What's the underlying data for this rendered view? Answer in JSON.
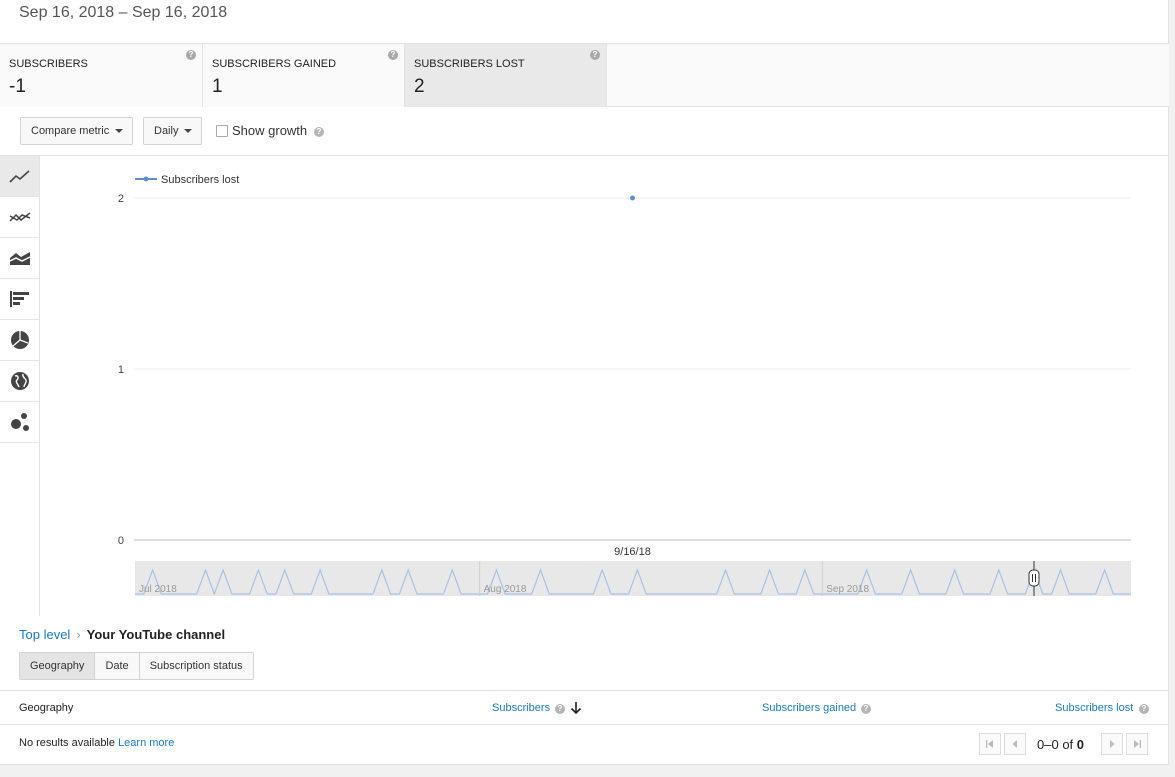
{
  "header": {
    "date_range": "Sep 16, 2018 – Sep 16, 2018"
  },
  "metrics": [
    {
      "label": "SUBSCRIBERS",
      "value": "-1"
    },
    {
      "label": "SUBSCRIBERS GAINED",
      "value": "1"
    },
    {
      "label": "SUBSCRIBERS LOST",
      "value": "2",
      "selected": true
    }
  ],
  "help_glyph": "?",
  "controls": {
    "compare_metric": "Compare metric",
    "interval": "Daily",
    "show_growth": "Show growth",
    "show_growth_checked": false
  },
  "sidebar": {
    "icons": [
      "line-chart-icon",
      "multiline-chart-icon",
      "stacked-area-chart-icon",
      "bar-chart-icon",
      "pie-chart-icon",
      "globe-map-icon",
      "bubble-chart-icon"
    ],
    "active_index": 0
  },
  "chart_data": {
    "type": "line",
    "title": "",
    "legend": {
      "entries": [
        "Subscribers lost"
      ],
      "placement": "top-left"
    },
    "x": [
      "9/16/18"
    ],
    "series": [
      {
        "name": "Subscribers lost",
        "values": [
          2
        ],
        "color": "#5b8fd6"
      }
    ],
    "ylim": [
      0,
      2
    ],
    "yticks": [
      "0",
      "1",
      "2"
    ],
    "xlabel": "",
    "ylabel": "",
    "grid": true,
    "overview": {
      "months": [
        "Jul 2018",
        "Aug 2018",
        "Sep 2018"
      ],
      "values": [
        0,
        0,
        1,
        0,
        0,
        0,
        0,
        0,
        1,
        0,
        1,
        0,
        0,
        0,
        1,
        0,
        0,
        1,
        0,
        0,
        0,
        1,
        0,
        0,
        0,
        0,
        0,
        0,
        1,
        0,
        0,
        1,
        0,
        0,
        0,
        0,
        1,
        0,
        0,
        0,
        0,
        1,
        0,
        0,
        0,
        0,
        1,
        0,
        0,
        0,
        0,
        0,
        0,
        1,
        0,
        0,
        0,
        1,
        0,
        0,
        0,
        0,
        0,
        0,
        0,
        0,
        0,
        1,
        0,
        0,
        0,
        0,
        1,
        0,
        0,
        0,
        1,
        0,
        0,
        0,
        0,
        0,
        0,
        1,
        0,
        0,
        0,
        0,
        1,
        0,
        0,
        0,
        0,
        1,
        0,
        0,
        0,
        0,
        1,
        0,
        0,
        0,
        1,
        0,
        0,
        1,
        0,
        0,
        0,
        0,
        1,
        0,
        0,
        0
      ]
    }
  },
  "breadcrumb": {
    "top": "Top level",
    "separator": "›",
    "current": "Your YouTube channel"
  },
  "tabs": [
    "Geography",
    "Date",
    "Subscription status"
  ],
  "table": {
    "columns": [
      "Geography",
      "Subscribers",
      "Subscribers gained",
      "Subscribers lost"
    ],
    "sort_icon": "arrow-down-icon",
    "no_results": "No results available",
    "learn_more": "Learn more"
  },
  "pager": {
    "range": "0–0",
    "of": "of",
    "total": "0"
  },
  "colors": {
    "accent": "#167ac6",
    "series": "#5b8fd6",
    "selected_bg": "#e9e9e9"
  }
}
